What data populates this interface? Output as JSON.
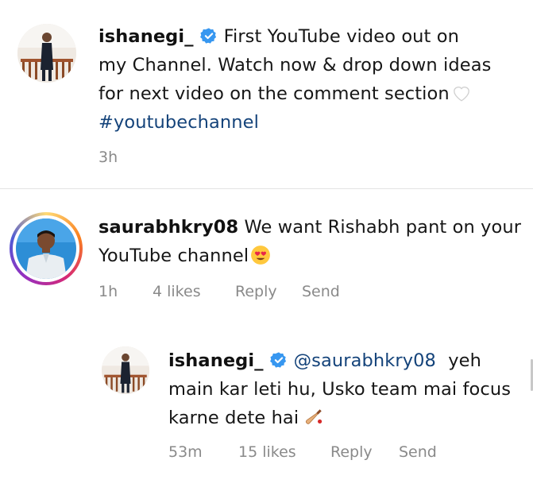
{
  "post": {
    "username": "ishanegi_",
    "caption_lines": [
      "First YouTube video out on",
      "my Channel. Watch now & drop down ideas",
      "for next video on the comment section"
    ],
    "hashtag": "#youtubechannel",
    "time": "3h",
    "verified_icon": "verified-badge-icon",
    "caption_emoji": "white-heart-emoji"
  },
  "comment": {
    "username": "saurabhkry08",
    "text_line1": "We want Rishabh pant on your",
    "text_line2": "YouTube channel",
    "emoji": "heart-eyes-emoji",
    "time": "1h",
    "likes": "4 likes",
    "reply_label": "Reply",
    "send_label": "Send"
  },
  "reply": {
    "username": "ishanegi_",
    "mention": "@saurabhkry08",
    "text_line1_suffix": "yeh",
    "text_line2": "main kar leti hu, Usko team mai focus",
    "text_line3": "karne dete hai",
    "emoji": "cricket-bat-emoji",
    "time": "53m",
    "likes": "15 likes",
    "reply_label": "Reply",
    "send_label": "Send"
  },
  "colors": {
    "text": "#161616",
    "meta": "#8a8a8a",
    "hashtag": "#14437a",
    "verified": "#3797f0"
  }
}
